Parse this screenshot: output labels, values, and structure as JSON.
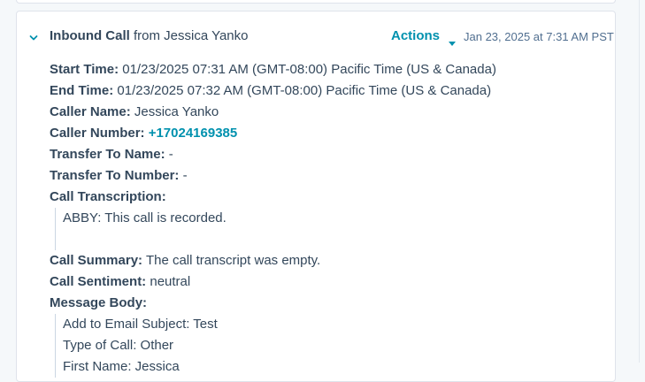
{
  "header": {
    "call_type": "Inbound Call",
    "from_text": " from Jessica Yanko",
    "actions_label": "Actions",
    "timestamp": "Jan 23, 2025 at 7:31 AM PST"
  },
  "details": {
    "start_time": {
      "label": "Start Time:",
      "value": " 01/23/2025 07:31 AM (GMT-08:00) Pacific Time (US & Canada)"
    },
    "end_time": {
      "label": "End Time:",
      "value": " 01/23/2025 07:32 AM (GMT-08:00) Pacific Time (US & Canada)"
    },
    "caller_name": {
      "label": "Caller Name:",
      "value": " Jessica Yanko"
    },
    "caller_number": {
      "label": "Caller Number:",
      "value": "+17024169385"
    },
    "transfer_to_name": {
      "label": "Transfer To Name:",
      "value": " -"
    },
    "transfer_to_number": {
      "label": "Transfer To Number:",
      "value": " -"
    },
    "call_transcription": {
      "label": "Call Transcription:",
      "text": "ABBY: This call is recorded."
    },
    "call_summary": {
      "label": "Call Summary:",
      "value": " The call transcript was empty."
    },
    "call_sentiment": {
      "label": "Call Sentiment:",
      "value": " neutral"
    },
    "message_body": {
      "label": "Message Body:",
      "lines": [
        "Add to Email Subject: Test",
        "Type of Call: Other",
        "First Name: Jessica"
      ]
    }
  },
  "colors": {
    "accent": "#0091ae",
    "text": "#33475b",
    "muted": "#516f90",
    "border": "#dfe3eb"
  },
  "icons": {
    "expand": "chevron-down-icon",
    "actions": "caret-down-icon"
  }
}
